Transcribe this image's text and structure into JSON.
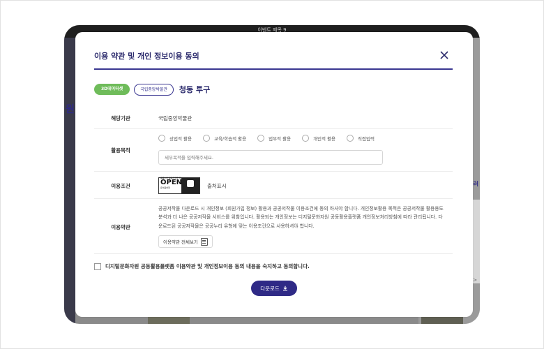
{
  "background": {
    "device_title": "이벤트 제목 9",
    "left_peek_text": "원",
    "right_peek_text": "컬러",
    "right_small_text": "K>"
  },
  "modal": {
    "title": "이용 약관 및 개인 정보이용 동의",
    "tags": [
      "3D데이터셋",
      "국립중앙박물관"
    ],
    "item_title": "청동 투구",
    "rows": {
      "institution": {
        "label": "해당기관",
        "value": "국립중앙박물관"
      },
      "purpose": {
        "label": "활용목적",
        "options": [
          "상업적 활용",
          "교육/학습적 활용",
          "업무적 활용",
          "개인적 활용",
          "직접입력"
        ],
        "input_placeholder": "세부목적을 입력해주세요."
      },
      "license": {
        "label": "이용조건",
        "ogl_word": "OPEN",
        "ogl_caption": "공공누리 공공저작물 자유이용허락",
        "attribution": "출처표시"
      },
      "terms": {
        "label": "이용약관",
        "text": "공공저작물 다운로드 시 개인정보 (회원가입 정보) 활용과 공공저작물 이용조건에 동의 하셔야 합니다. 개인정보활용 목적은 공공저작물 활용용도 분석과 더 나은 공공저작물 서비스를 위함입니다. 활용되는 개인정보는 디지털문화자원 공동활용플랫폼 개인정보처리방침에 따라 관리됩니다. 다운로드된 공공저작물은 공공누리 유형에 맞는 이용조건으로 사용하셔야 합니다.",
        "view_all_button": "이용약관 전체보기"
      }
    },
    "agree_text": "디지털문화자원 공동활용플랫폼 이용약관 및 개인정보이용 동의 내용을 숙지하고 동의합니다.",
    "download_label": "다운로드"
  },
  "colors": {
    "accent": "#2f2a86",
    "tag_green": "#6fbc5a"
  }
}
